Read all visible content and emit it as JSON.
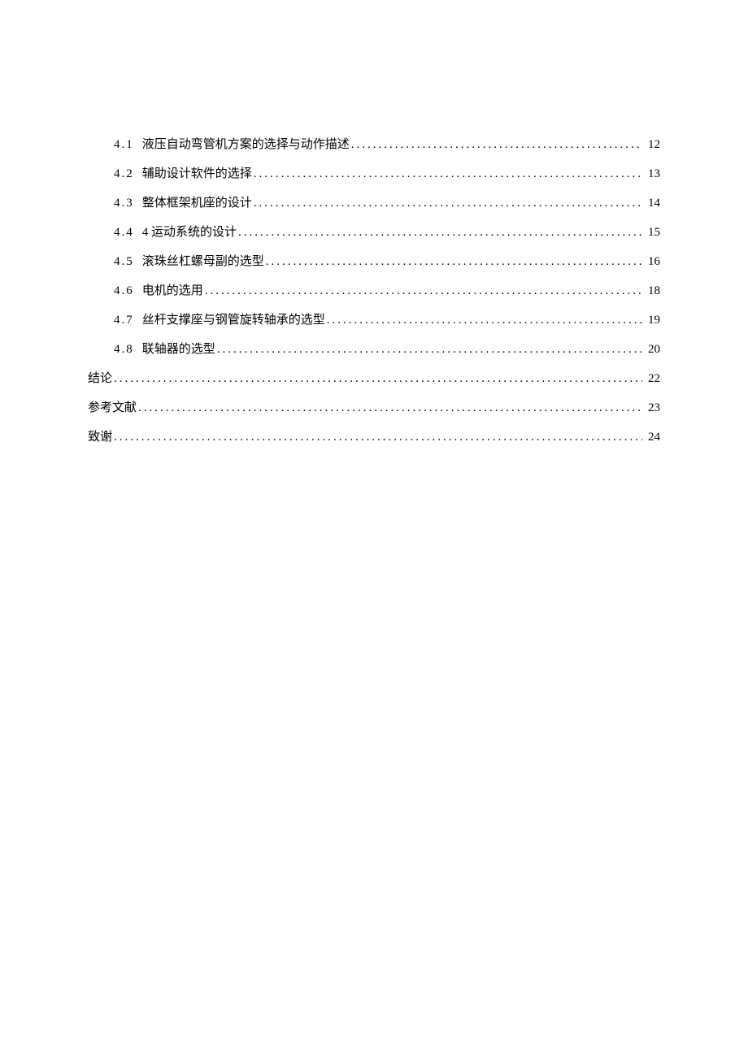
{
  "toc": {
    "entries": [
      {
        "level": 2,
        "num": "4.1",
        "title": "液压自动弯管机方案的选择与动作描述",
        "page": "12"
      },
      {
        "level": 2,
        "num": "4.2",
        "title": "辅助设计软件的选择",
        "page": "13"
      },
      {
        "level": 2,
        "num": "4.3",
        "title": "整体框架机座的设计",
        "page": "14"
      },
      {
        "level": 2,
        "num": "4.4",
        "title": "4 运动系统的设计",
        "page": "15"
      },
      {
        "level": 2,
        "num": "4.5",
        "title": "滚珠丝杠螺母副的选型",
        "page": "16"
      },
      {
        "level": 2,
        "num": "4.6",
        "title": "电机的选用",
        "page": "18"
      },
      {
        "level": 2,
        "num": "4.7",
        "title": "丝杆支撑座与钢管旋转轴承的选型",
        "page": "19"
      },
      {
        "level": 2,
        "num": "4.8",
        "title": "联轴器的选型",
        "page": "20"
      },
      {
        "level": 1,
        "num": "",
        "title": "结论",
        "page": "22"
      },
      {
        "level": 1,
        "num": "",
        "title": "参考文献",
        "page": "23"
      },
      {
        "level": 1,
        "num": "",
        "title": "致谢",
        "page": "24"
      }
    ]
  }
}
